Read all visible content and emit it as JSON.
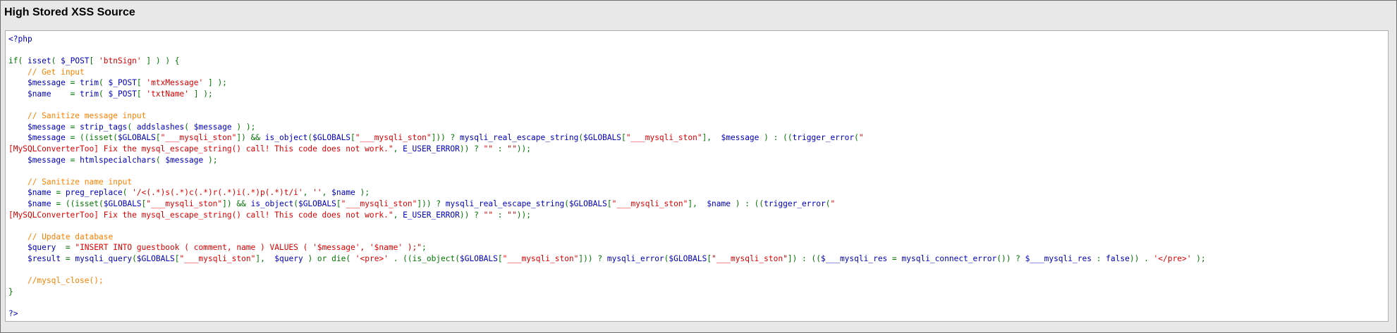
{
  "panel": {
    "title": "High Stored XSS Source"
  },
  "code": {
    "lines": [
      [
        [
          "html",
          "<?php"
        ]
      ],
      [],
      [
        [
          "kw",
          "if( "
        ],
        [
          "var",
          "isset"
        ],
        [
          "kw",
          "( "
        ],
        [
          "var",
          "$_POST"
        ],
        [
          "kw",
          "[ "
        ],
        [
          "str",
          "'btnSign'"
        ],
        [
          "kw",
          " ] ) ) {"
        ]
      ],
      [
        [
          "kw",
          "    "
        ],
        [
          "com",
          "// Get input"
        ]
      ],
      [
        [
          "kw",
          "    "
        ],
        [
          "var",
          "$message"
        ],
        [
          "kw",
          " = "
        ],
        [
          "var",
          "trim"
        ],
        [
          "kw",
          "( "
        ],
        [
          "var",
          "$_POST"
        ],
        [
          "kw",
          "[ "
        ],
        [
          "str",
          "'mtxMessage'"
        ],
        [
          "kw",
          " ] );"
        ]
      ],
      [
        [
          "kw",
          "    "
        ],
        [
          "var",
          "$name"
        ],
        [
          "kw",
          "    = "
        ],
        [
          "var",
          "trim"
        ],
        [
          "kw",
          "( "
        ],
        [
          "var",
          "$_POST"
        ],
        [
          "kw",
          "[ "
        ],
        [
          "str",
          "'txtName'"
        ],
        [
          "kw",
          " ] );"
        ]
      ],
      [],
      [
        [
          "kw",
          "    "
        ],
        [
          "com",
          "// Sanitize message input"
        ]
      ],
      [
        [
          "kw",
          "    "
        ],
        [
          "var",
          "$message"
        ],
        [
          "kw",
          " = "
        ],
        [
          "var",
          "strip_tags"
        ],
        [
          "kw",
          "( "
        ],
        [
          "var",
          "addslashes"
        ],
        [
          "kw",
          "( "
        ],
        [
          "var",
          "$message"
        ],
        [
          "kw",
          " ) );"
        ]
      ],
      [
        [
          "kw",
          "    "
        ],
        [
          "var",
          "$message"
        ],
        [
          "kw",
          " = ((isset("
        ],
        [
          "var",
          "$GLOBALS"
        ],
        [
          "kw",
          "["
        ],
        [
          "str",
          "\"___mysqli_ston\""
        ],
        [
          "kw",
          "]) && "
        ],
        [
          "var",
          "is_object"
        ],
        [
          "kw",
          "("
        ],
        [
          "var",
          "$GLOBALS"
        ],
        [
          "kw",
          "["
        ],
        [
          "str",
          "\"___mysqli_ston\""
        ],
        [
          "kw",
          "])) ? "
        ],
        [
          "var",
          "mysqli_real_escape_string"
        ],
        [
          "kw",
          "("
        ],
        [
          "var",
          "$GLOBALS"
        ],
        [
          "kw",
          "["
        ],
        [
          "str",
          "\"___mysqli_ston\""
        ],
        [
          "kw",
          "],  "
        ],
        [
          "var",
          "$message"
        ],
        [
          "kw",
          " ) : (("
        ],
        [
          "var",
          "trigger_error"
        ],
        [
          "kw",
          "("
        ],
        [
          "str",
          "\""
        ]
      ],
      [
        [
          "str",
          "[MySQLConverterToo] Fix the mysql_escape_string() call! This code does not work.\""
        ],
        [
          "kw",
          ", "
        ],
        [
          "var",
          "E_USER_ERROR"
        ],
        [
          "kw",
          ")) ? "
        ],
        [
          "str",
          "\"\""
        ],
        [
          "kw",
          " : "
        ],
        [
          "str",
          "\"\""
        ],
        [
          "kw",
          "));"
        ]
      ],
      [
        [
          "kw",
          "    "
        ],
        [
          "var",
          "$message"
        ],
        [
          "kw",
          " = "
        ],
        [
          "var",
          "htmlspecialchars"
        ],
        [
          "kw",
          "( "
        ],
        [
          "var",
          "$message"
        ],
        [
          "kw",
          " );"
        ]
      ],
      [],
      [
        [
          "kw",
          "    "
        ],
        [
          "com",
          "// Sanitize name input"
        ]
      ],
      [
        [
          "kw",
          "    "
        ],
        [
          "var",
          "$name"
        ],
        [
          "kw",
          " = "
        ],
        [
          "var",
          "preg_replace"
        ],
        [
          "kw",
          "( "
        ],
        [
          "str",
          "'/<(.*)s(.*)c(.*)r(.*)i(.*)p(.*)t/i'"
        ],
        [
          "kw",
          ", "
        ],
        [
          "str",
          "''"
        ],
        [
          "kw",
          ", "
        ],
        [
          "var",
          "$name"
        ],
        [
          "kw",
          " );"
        ]
      ],
      [
        [
          "kw",
          "    "
        ],
        [
          "var",
          "$name"
        ],
        [
          "kw",
          " = ((isset("
        ],
        [
          "var",
          "$GLOBALS"
        ],
        [
          "kw",
          "["
        ],
        [
          "str",
          "\"___mysqli_ston\""
        ],
        [
          "kw",
          "]) && "
        ],
        [
          "var",
          "is_object"
        ],
        [
          "kw",
          "("
        ],
        [
          "var",
          "$GLOBALS"
        ],
        [
          "kw",
          "["
        ],
        [
          "str",
          "\"___mysqli_ston\""
        ],
        [
          "kw",
          "])) ? "
        ],
        [
          "var",
          "mysqli_real_escape_string"
        ],
        [
          "kw",
          "("
        ],
        [
          "var",
          "$GLOBALS"
        ],
        [
          "kw",
          "["
        ],
        [
          "str",
          "\"___mysqli_ston\""
        ],
        [
          "kw",
          "],  "
        ],
        [
          "var",
          "$name"
        ],
        [
          "kw",
          " ) : (("
        ],
        [
          "var",
          "trigger_error"
        ],
        [
          "kw",
          "("
        ],
        [
          "str",
          "\""
        ]
      ],
      [
        [
          "str",
          "[MySQLConverterToo] Fix the mysql_escape_string() call! This code does not work.\""
        ],
        [
          "kw",
          ", "
        ],
        [
          "var",
          "E_USER_ERROR"
        ],
        [
          "kw",
          ")) ? "
        ],
        [
          "str",
          "\"\""
        ],
        [
          "kw",
          " : "
        ],
        [
          "str",
          "\"\""
        ],
        [
          "kw",
          "));"
        ]
      ],
      [],
      [
        [
          "kw",
          "    "
        ],
        [
          "com",
          "// Update database"
        ]
      ],
      [
        [
          "kw",
          "    "
        ],
        [
          "var",
          "$query"
        ],
        [
          "kw",
          "  = "
        ],
        [
          "str",
          "\"INSERT INTO guestbook ( comment, name ) VALUES ( '$message', '$name' );\""
        ],
        [
          "kw",
          ";"
        ]
      ],
      [
        [
          "kw",
          "    "
        ],
        [
          "var",
          "$result"
        ],
        [
          "kw",
          " = "
        ],
        [
          "var",
          "mysqli_query"
        ],
        [
          "kw",
          "("
        ],
        [
          "var",
          "$GLOBALS"
        ],
        [
          "kw",
          "["
        ],
        [
          "str",
          "\"___mysqli_ston\""
        ],
        [
          "kw",
          "],  "
        ],
        [
          "var",
          "$query"
        ],
        [
          "kw",
          " ) or die( "
        ],
        [
          "str",
          "'<pre>'"
        ],
        [
          "kw",
          " . ((is_object("
        ],
        [
          "var",
          "$GLOBALS"
        ],
        [
          "kw",
          "["
        ],
        [
          "str",
          "\"___mysqli_ston\""
        ],
        [
          "kw",
          "])) ? "
        ],
        [
          "var",
          "mysqli_error"
        ],
        [
          "kw",
          "("
        ],
        [
          "var",
          "$GLOBALS"
        ],
        [
          "kw",
          "["
        ],
        [
          "str",
          "\"___mysqli_ston\""
        ],
        [
          "kw",
          "]) : (("
        ],
        [
          "var",
          "$___mysqli_res"
        ],
        [
          "kw",
          " = "
        ],
        [
          "var",
          "mysqli_connect_error"
        ],
        [
          "kw",
          "()) ? "
        ],
        [
          "var",
          "$___mysqli_res"
        ],
        [
          "kw",
          " : "
        ],
        [
          "var",
          "false"
        ],
        [
          "kw",
          ")) . "
        ],
        [
          "str",
          "'</pre>'"
        ],
        [
          "kw",
          " );"
        ]
      ],
      [],
      [
        [
          "kw",
          "    "
        ],
        [
          "com",
          "//mysql_close();"
        ]
      ],
      [
        [
          "kw",
          "}"
        ]
      ],
      [],
      [
        [
          "html",
          "?>"
        ]
      ]
    ]
  },
  "colors": {
    "html": "#0000bb",
    "keyword": "#007700",
    "variable": "#0000bb",
    "string": "#dd0000",
    "comment": "#ff8000"
  }
}
